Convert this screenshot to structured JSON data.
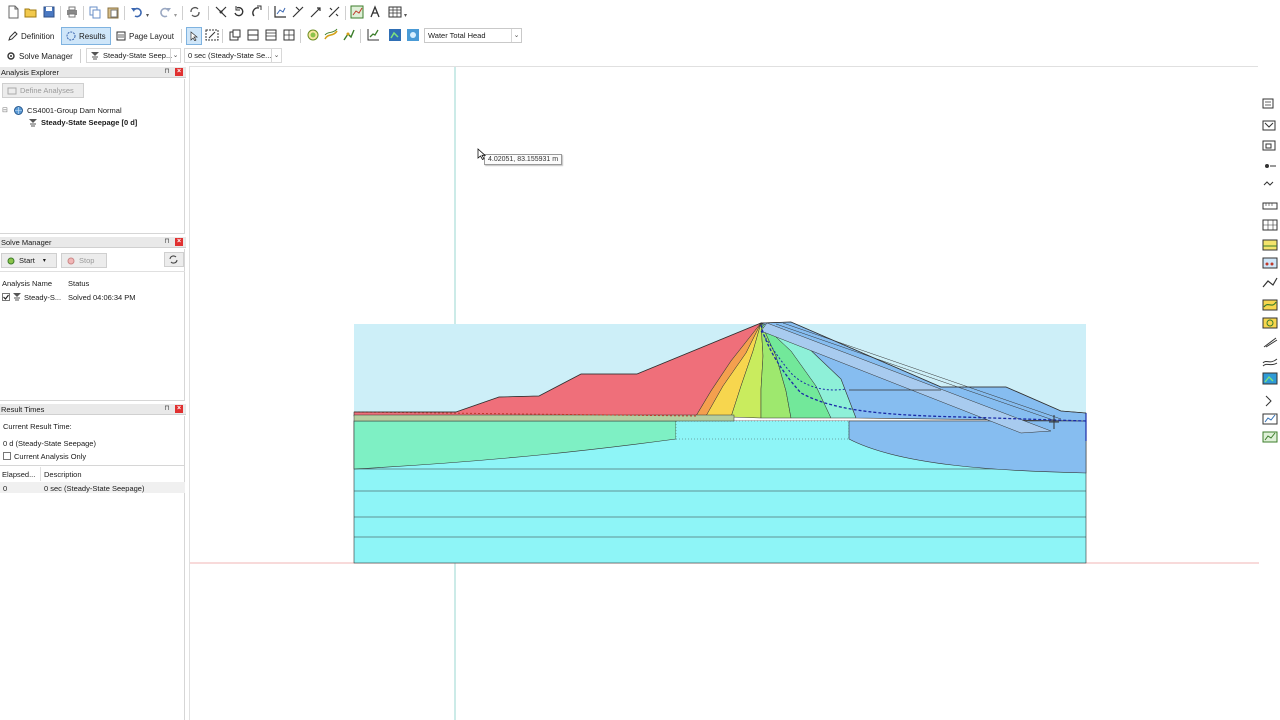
{
  "toolbar_modes": {
    "definition": "Definition",
    "results": "Results",
    "page_layout": "Page Layout",
    "contour_select": "Water Total Head"
  },
  "toolbar_solve": {
    "solve_manager": "Solve Manager",
    "analysis_select": "Steady-State Seep...",
    "time_select": "0 sec (Steady-State Se..."
  },
  "analysis_explorer": {
    "title": "Analysis Explorer",
    "define_button": "Define Analyses",
    "tree_project": "CS4001-Group Dam Normal",
    "tree_analysis": "Steady-State Seepage [0 d]"
  },
  "solve_manager": {
    "title": "Solve Manager",
    "start": "Start",
    "stop": "Stop",
    "col_name": "Analysis Name",
    "col_status": "Status",
    "rows": [
      {
        "name": "Steady-S...",
        "status": "Solved 04:06:34 PM"
      }
    ]
  },
  "result_times": {
    "title": "Result Times",
    "current_label": "Current Result Time:",
    "current_value": "0 d (Steady-State Seepage)",
    "current_only": "Current Analysis Only",
    "col_elapsed": "Elapsed...",
    "col_description": "Description",
    "rows": [
      {
        "elapsed": "0",
        "description": "0 sec (Steady-State Seepage)"
      }
    ]
  },
  "canvas": {
    "cursor_readout": "4.02051, 83.155931 m"
  },
  "colors": {
    "accent": "#cfe6f9",
    "close": "#e03030",
    "sky": "#cdeff8",
    "foundation": "#8ef5f7",
    "head_high": "#ef6f7a",
    "head_low": "#7fb4ee"
  },
  "icons": {
    "toolbar1": [
      "new-file-icon",
      "open-folder-icon",
      "save-icon",
      "print-icon",
      "copy-icon",
      "paste-icon",
      "undo-icon",
      "redo-icon",
      "refresh-icon",
      "select-icon",
      "rotate-icon",
      "zoom-icon",
      "axes-icon",
      "grid-icon",
      "sketch-icon",
      "table-icon"
    ]
  }
}
